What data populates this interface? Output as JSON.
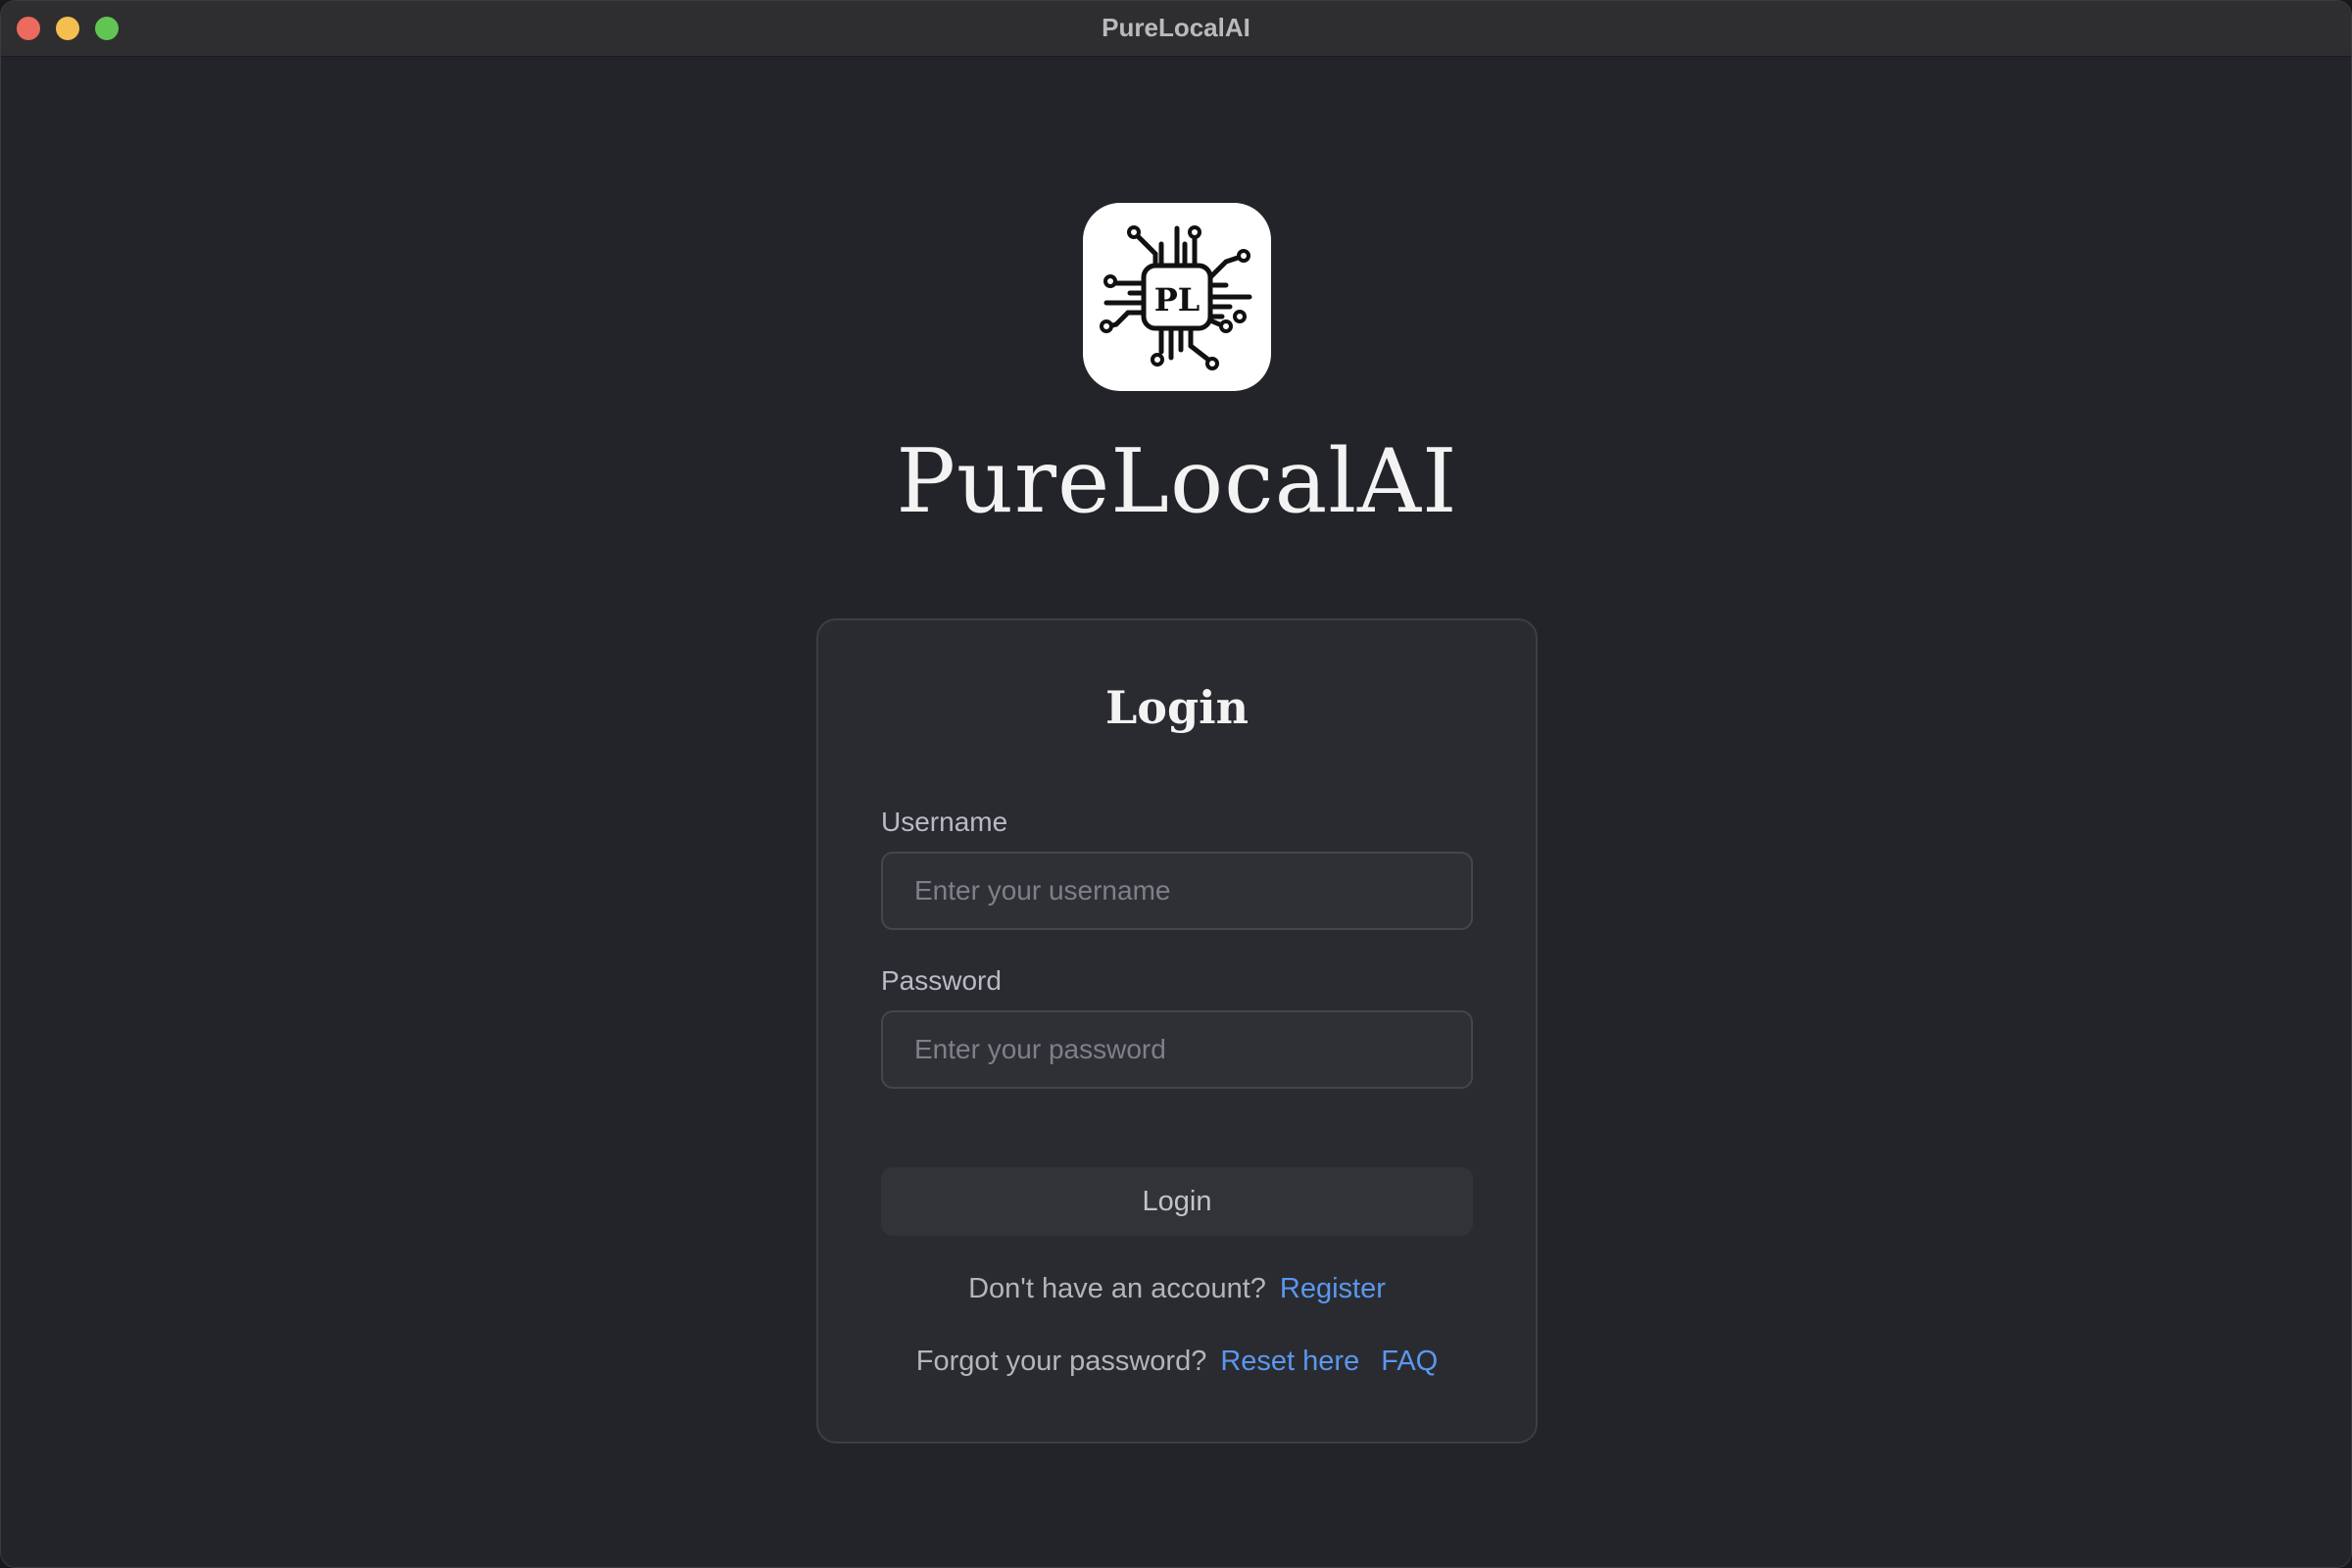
{
  "window": {
    "title": "PureLocalAI"
  },
  "branding": {
    "logo_icon": "chip-pl-logo",
    "logo_text": "PL",
    "app_name": "PureLocalAI"
  },
  "login_form": {
    "title": "Login",
    "username_label": "Username",
    "username_placeholder": "Enter your username",
    "username_value": "",
    "password_label": "Password",
    "password_placeholder": "Enter your password",
    "password_value": "",
    "submit_label": "Login"
  },
  "footer": {
    "register_prompt": "Don't have an account?",
    "register_link": "Register",
    "forgot_prompt": "Forgot your password?",
    "reset_link": "Reset here",
    "faq_link": "FAQ"
  },
  "colors": {
    "background": "#232429",
    "card": "#2a2b30",
    "link": "#5b97ee",
    "close": "#ec6a5e",
    "minimize": "#f4bf4f",
    "maximize": "#61c554"
  }
}
